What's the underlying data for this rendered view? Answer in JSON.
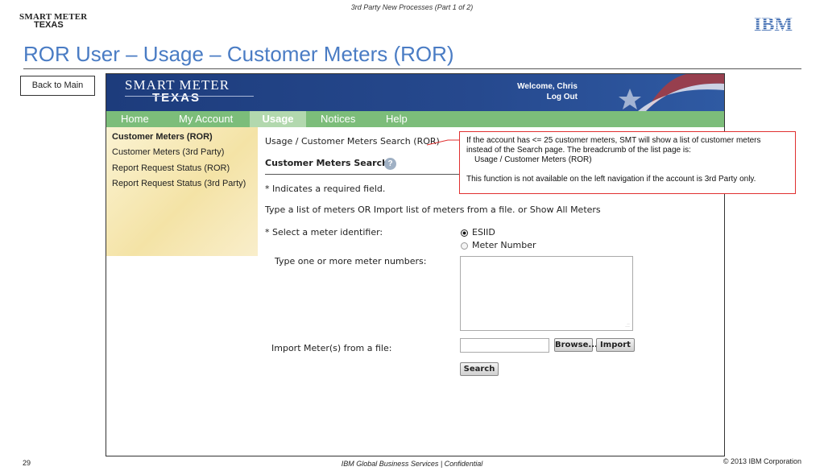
{
  "slide": {
    "header": "3rd Party New Processes (Part 1 of 2)",
    "title": "ROR User – Usage – Customer Meters (ROR)",
    "logo_line1": "SMART METER",
    "logo_line2": "TEXAS",
    "ibm_logo": "IBM",
    "back_button": "Back to Main",
    "page_number": "29",
    "footer_center": "IBM Global Business Services |  Confidential",
    "footer_right": "© 2013 IBM Corporation"
  },
  "app": {
    "logo_line1": "SMART METER",
    "logo_line2": "TEXAS",
    "welcome": "Welcome, Chris",
    "logout": "Log Out",
    "nav": [
      {
        "label": "Home"
      },
      {
        "label": "My Account"
      },
      {
        "label": "Usage"
      },
      {
        "label": "Notices"
      },
      {
        "label": "Help"
      }
    ],
    "leftnav": [
      {
        "label": "Customer Meters (ROR)"
      },
      {
        "label": "Customer Meters (3rd Party)"
      },
      {
        "label": "Report Request Status (ROR)"
      },
      {
        "label": "Report Request Status (3rd Party)"
      }
    ],
    "breadcrumb": "Usage / Customer Meters Search (ROR)",
    "section_title": "Customer Meters Search",
    "required_note": "* Indicates a required field.",
    "instructions": "Type a list of meters OR Import list of meters from a file. or Show All Meters",
    "select_label": "*  Select a meter identifier:",
    "radio_options": [
      {
        "label": "ESIID",
        "selected": true
      },
      {
        "label": "Meter Number",
        "selected": false
      }
    ],
    "type_label": "Type one or more meter numbers:",
    "import_label": "Import Meter(s) from a file:",
    "browse_button": "Browse...",
    "import_button": "Import",
    "search_button": "Search"
  },
  "callout": {
    "line1": "If the account has <= 25 customer meters, SMT will show a list of customer meters",
    "line2": "instead of the Search page. The breadcrumb of the list page is:",
    "line3": "Usage / Customer Meters (ROR)",
    "line4": "This function is not available on the left navigation if the account is 3rd Party only."
  },
  "colors": {
    "title_blue": "#4a7cc4",
    "header_navy": "#1d3c7c",
    "nav_green": "#7cbd7a",
    "callout_red": "#e03030"
  }
}
